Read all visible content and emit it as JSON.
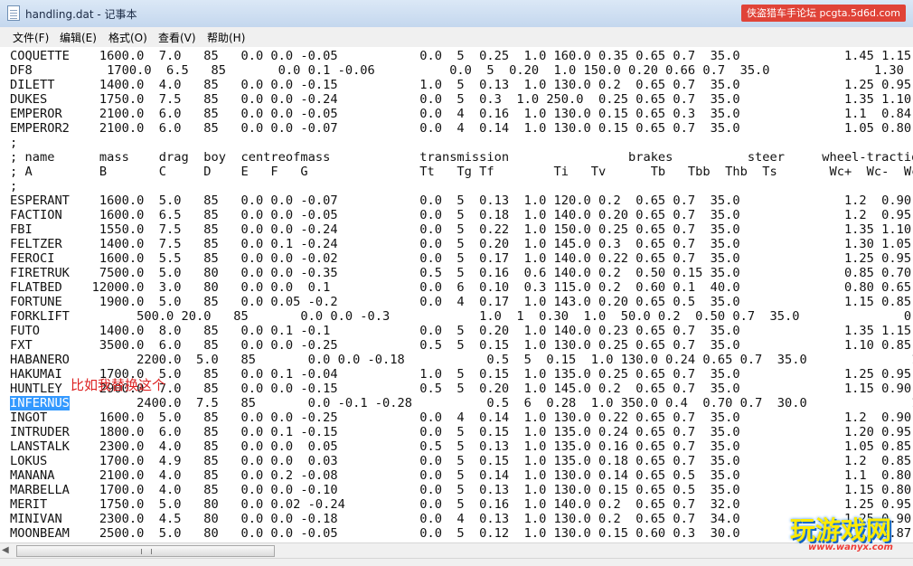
{
  "window": {
    "title": "handling.dat - 记事本",
    "watermark_top": "侠盗猎车手论坛 pcgta.5d6d.com"
  },
  "menu": [
    "文件(F)",
    "编辑(E)",
    "格式(O)",
    "查看(V)",
    "帮助(H)"
  ],
  "text_lines": [
    "COQUETTE    1600.0  7.0   85   0.0 0.0 -0.05           0.0  5  0.25  1.0 160.0 0.35 0.65 0.7  35.0              1.45 1.15 14.",
    "DF8          1700.0  6.5   85       0.0 0.1 -0.06          0.0  5  0.20  1.0 150.0 0.20 0.66 0.7  35.0              1.30",
    "DILETT      1400.0  4.0   85   0.0 0.0 -0.15           1.0  5  0.13  1.0 130.0 0.2  0.65 0.7  35.0              1.25 0.95 14.",
    "DUKES       1750.0  7.5   85   0.0 0.0 -0.24           0.0  5  0.3  1.0 250.0  0.25 0.65 0.7  35.0              1.35 1.10 13.",
    "EMPEROR     2100.0  6.0   85   0.0 0.0 -0.05           0.0  4  0.16  1.0 130.0 0.15 0.65 0.3  35.0              1.1  0.84 13.",
    "EMPEROR2    2100.0  6.0   85   0.0 0.0 -0.07           0.0  4  0.14  1.0 130.0 0.15 0.65 0.7  35.0              1.05 0.80 13.",
    ";",
    "; name      mass    drag  boy  centreofmass            transmission                brakes          steer     wheel-tractio",
    "; A         B       C     D    E   F   G               Tt   Tg Tf        Ti   Tv      Tb   Tbb  Thb  Ts       Wc+  Wc-  Wc-",
    ";",
    "ESPERANT    1600.0  5.0   85   0.0 0.0 -0.07           0.0  5  0.13  1.0 120.0 0.2  0.65 0.7  35.0              1.2  0.90 13.",
    "FACTION     1600.0  6.5   85   0.0 0.0 -0.05           0.0  5  0.18  1.0 140.0 0.20 0.65 0.7  35.0              1.2  0.95 14.",
    "FBI         1550.0  7.5   85   0.0 0.0 -0.24           0.0  5  0.22  1.0 150.0 0.25 0.65 0.7  35.0              1.35 1.10 13.",
    "FELTZER     1400.0  7.5   85   0.0 0.1 -0.24           0.0  5  0.20  1.0 145.0 0.3  0.65 0.7  35.0              1.30 1.05 13.",
    "FEROCI      1600.0  5.5   85   0.0 0.0 -0.02           0.0  5  0.17  1.0 140.0 0.22 0.65 0.7  35.0              1.25 0.95 16.",
    "FIRETRUK    7500.0  5.0   80   0.0 0.0 -0.35           0.5  5  0.16  0.6 140.0 0.2  0.50 0.15 35.0              0.85 0.70 13.",
    "FLATBED    12000.0  3.0   80   0.0 0.0  0.1            0.0  6  0.10  0.3 115.0 0.2  0.60 0.1  40.0              0.80 0.65 12.",
    "FORTUNE     1900.0  5.0   85   0.0 0.05 -0.2           0.0  4  0.17  1.0 143.0 0.20 0.65 0.5  35.0              1.15 0.85 15.",
    "FORKLIFT         500.0 20.0   85       0.0 0.0 -0.3            1.0  1  0.30  1.0  50.0 0.2  0.50 0.7  35.0              0.90",
    "FUTO        1400.0  8.0   85   0.0 0.1 -0.1            0.0  5  0.20  1.0 140.0 0.23 0.65 0.7  35.0              1.35 1.15 13.",
    "FXT         3500.0  6.0   85   0.0 0.0 -0.25           0.5  5  0.15  1.0 130.0 0.25 0.65 0.7  35.0              1.10 0.85 17.",
    "HABANERO         2200.0  5.0   85       0.0 0.0 -0.18           0.5  5  0.15  1.0 130.0 0.24 0.65 0.7  35.0              1.1",
    "HAKUMAI     1700.0  5.0   85   0.0 0.1 -0.04           1.0  5  0.15  1.0 135.0 0.25 0.65 0.7  35.0              1.25 0.95 12.",
    "HUNTLEY     2900.0  7.0   85   0.0 0.0 -0.15           0.5  5  0.20  1.0 145.0 0.2  0.65 0.7  35.0              1.15 0.90 14.",
    "INFERNUS         2400.0  7.5   85       0.0 -0.1 -0.28          0.5  6  0.28  1.0 350.0 0.4  0.70 0.7  30.0              1.50",
    "INGOT       1600.0  5.0   85   0.0 0.0 -0.25           0.0  4  0.14  1.0 130.0 0.22 0.65 0.7  35.0              1.2  0.90 14.",
    "INTRUDER    1800.0  6.0   85   0.0 0.1 -0.15           0.0  5  0.15  1.0 135.0 0.24 0.65 0.7  35.0              1.20 0.95 15.",
    "LANSTALK    2300.0  4.0   85   0.0 0.0  0.05           0.5  5  0.13  1.0 135.0 0.16 0.65 0.7  35.0              1.05 0.85 14.",
    "LOKUS       1700.0  4.9   85   0.0 0.0  0.03           0.0  5  0.15  1.0 135.0 0.18 0.65 0.7  35.0              1.2  0.85 12.",
    "MANANA      2100.0  4.0   85   0.0 0.2 -0.08           0.0  5  0.14  1.0 130.0 0.14 0.65 0.5  35.0              1.1  0.80 15.",
    "MARBELLA    1700.0  4.0   85   0.0 0.0 -0.10           0.0  5  0.13  1.0 130.0 0.15 0.65 0.5  35.0              1.15 0.80 14.",
    "MERIT       1750.0  5.0   80   0.0 0.02 -0.24          0.0  5  0.16  1.0 140.0 0.2  0.65 0.7  32.0              1.25 0.95 15.",
    "MINIVAN     2300.0  4.5   80   0.0 0.0 -0.18           0.0  4  0.13  1.0 130.0 0.2  0.65 0.7  34.0              1.25 0.90 13.",
    "MOONBEAM    2500.0  5.0   80   0.0 0.0 -0.05           0.0  5  0.12  1.0 130.0 0.15 0.60 0.3  30.0              1.15 0.87 12."
  ],
  "selected_line_index": 24,
  "selected_word": "INFERNUS",
  "annotation_text": "比如我替换这个",
  "logo": {
    "main": "玩游戏网",
    "url": "www.wanyx.com"
  }
}
